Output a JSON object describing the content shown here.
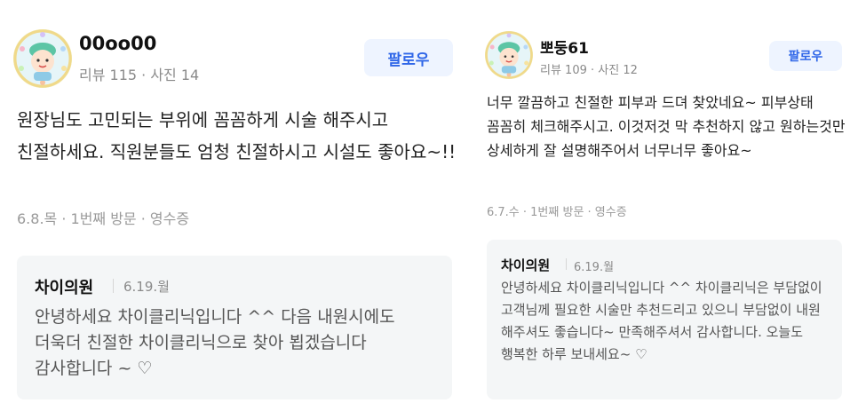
{
  "reviews": [
    {
      "user_name": "00oo00",
      "meta": "리뷰 115 · 사진 14",
      "follow_label": "팔로우",
      "body": "원장님도 고민되는 부위에 꼼꼼하게 시술 해주시고 친절하세요. 직원분들도 엄청 친절하시고 시설도 좋아요~!!",
      "visit_info": "6.8.목 · 1번째 방문 · 영수증",
      "reply": {
        "name": "차이의원",
        "date": "6.19.월",
        "text": "안녕하세요 차이클리닉입니다 ^^ 다음 내원시에도 더욱더 친절한 차이클리닉으로 찾아 뵙겠습니다 감사합니다 ~ ♡"
      }
    },
    {
      "user_name": "뽀둥61",
      "meta": "리뷰 109 · 사진 12",
      "follow_label": "팔로우",
      "body": "너무 깔끔하고 친절한 피부과 드뎌 찾았네요~ 피부상태 꼼꼼히 체크해주시고. 이것저것 막 추천하지 않고 원하는것만 상세하게 잘 설명해주어서 너무너무 좋아요~",
      "visit_info": "6.7.수 · 1번째 방문 · 영수증",
      "reply": {
        "name": "차이의원",
        "date": "6.19.월",
        "text": "안녕하세요 차이클리닉입니다 ^^ 차이클리닉은 부담없이 고객님께 필요한 시술만 추천드리고 있으니 부담없이 내원 해주셔도 좋습니다~ 만족해주셔서 감사합니다. 오늘도 행복한 하루 보내세요~ ♡"
      }
    }
  ],
  "colors": {
    "follow_text": "#2f66e8",
    "follow_bg": "#eef4ff",
    "reply_bg": "#f4f6f7"
  }
}
